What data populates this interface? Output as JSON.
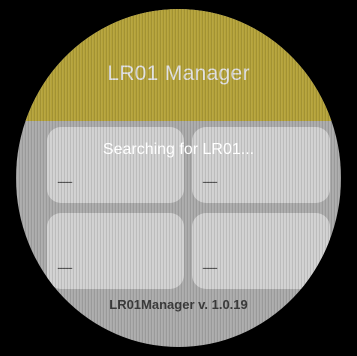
{
  "app": {
    "title": "LR01 Manager",
    "version_label": "LR01Manager v. 1.0.19"
  },
  "status": {
    "toast": "Searching for LR01..."
  },
  "tiles": [
    {
      "value": "—"
    },
    {
      "value": "—"
    },
    {
      "value": "—"
    },
    {
      "value": "—"
    }
  ],
  "colors": {
    "title_bar": "#c9b232",
    "background": "#bdbdbd",
    "tile": "#ececec"
  }
}
